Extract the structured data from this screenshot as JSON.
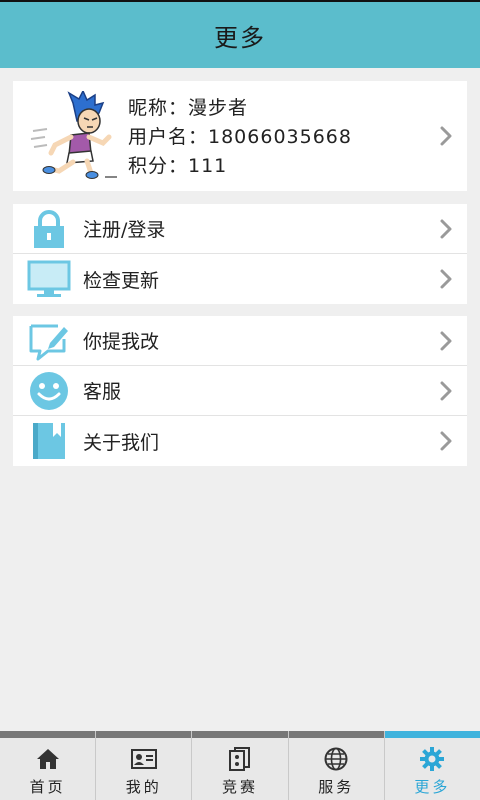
{
  "header": {
    "title": "更多"
  },
  "profile": {
    "nickname_line": "昵称：漫步者",
    "username_line": "用户名：18066035668",
    "points_line": "积分：111",
    "avatar_icon": "running-man-avatar"
  },
  "group1": {
    "items": [
      {
        "label": "注册/登录",
        "icon": "lock-icon"
      },
      {
        "label": "检查更新",
        "icon": "monitor-icon"
      }
    ]
  },
  "group2": {
    "items": [
      {
        "label": "你提我改",
        "icon": "edit-feedback-icon"
      },
      {
        "label": "客服",
        "icon": "smiley-icon"
      },
      {
        "label": "关于我们",
        "icon": "book-icon"
      }
    ]
  },
  "tabs": [
    {
      "label": "首页",
      "icon": "home-icon",
      "active": false
    },
    {
      "label": "我的",
      "icon": "id-card-icon",
      "active": false
    },
    {
      "label": "竞赛",
      "icon": "cards-icon",
      "active": false
    },
    {
      "label": "服务",
      "icon": "globe-icon",
      "active": false
    },
    {
      "label": "更多",
      "icon": "gear-icon",
      "active": true
    }
  ],
  "colors": {
    "header_bg": "#5bbdcc",
    "icon_blue": "#6cc7e3",
    "active_tab": "#2ba6d6",
    "page_bg": "#efefef"
  }
}
